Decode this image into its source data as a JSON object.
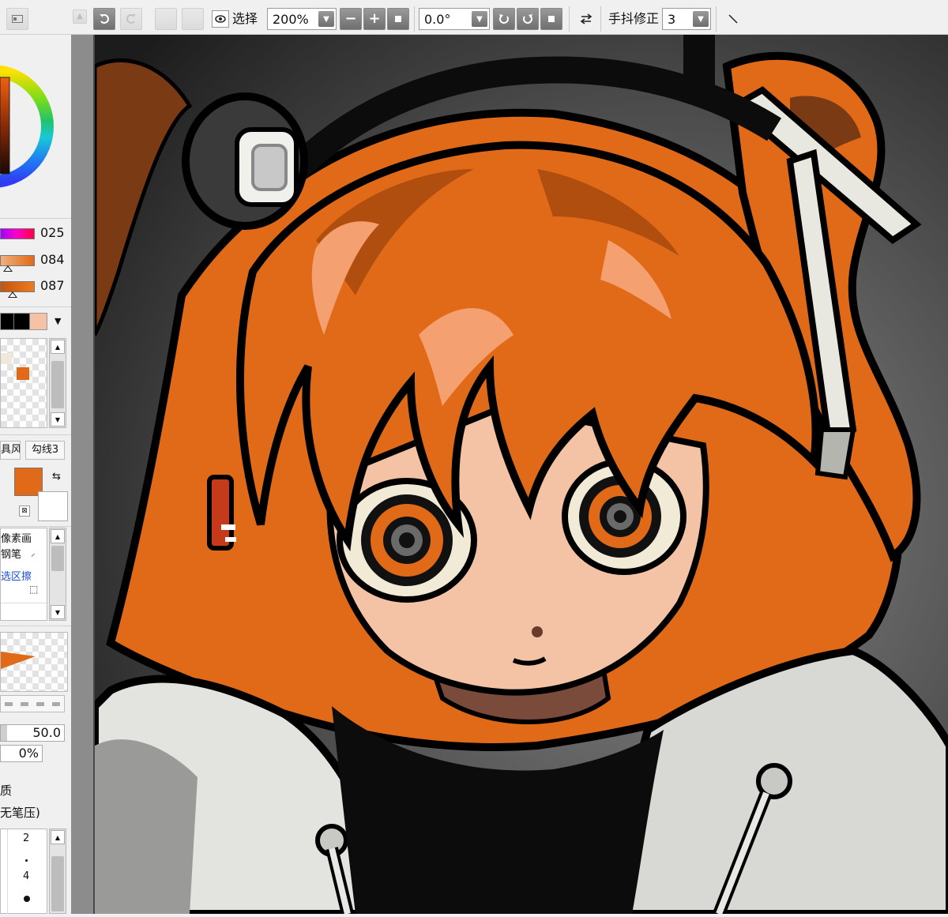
{
  "toolbar": {
    "select_label": "选择",
    "zoom_value": "200%",
    "rotation_value": "0.0°",
    "stabilizer_label": "手抖修正",
    "stabilizer_value": "3"
  },
  "color_sliders": [
    {
      "value": "025"
    },
    {
      "value": "084"
    },
    {
      "value": "087"
    }
  ],
  "brush_tabs": {
    "tab1": "具风",
    "tab2": "勾线3"
  },
  "tool_list": [
    {
      "label": "像素画"
    },
    {
      "label": "钢笔"
    },
    {
      "label": "选区擦"
    }
  ],
  "brush_settings": {
    "size_value": "50.0",
    "min_size_value": "0%",
    "texture_label": "质",
    "pressure_label": "无笔压)"
  },
  "brush_sizes": [
    "2",
    "4"
  ],
  "colors": {
    "main_color": "#e06a17",
    "sub_color": "#ffffff",
    "swatch_orange": "#e06a17",
    "swatch_peach": "#f4c3a6",
    "swatch_cream": "#f0e8d8"
  },
  "icons": {
    "undo": "undo-icon",
    "redo": "redo-icon",
    "eye": "eye-icon",
    "zoom_out": "minus-icon",
    "zoom_in": "plus-icon",
    "reset_zoom": "square-icon",
    "rotate_left": "rotate-left-icon",
    "rotate_right": "rotate-right-icon",
    "reset_rotation": "square-icon",
    "flip": "flip-horizontal-icon",
    "line": "line-tool-icon"
  }
}
